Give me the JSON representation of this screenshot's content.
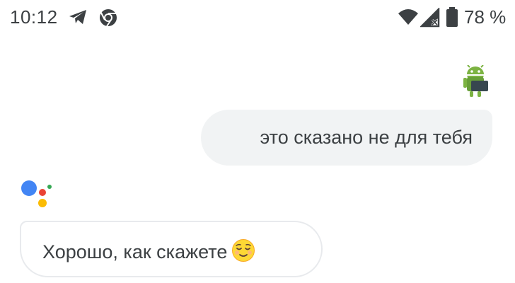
{
  "status_bar": {
    "time": "10:12",
    "left_icons": [
      "telegram-icon",
      "chrome-icon"
    ],
    "right_icons": [
      "wifi-icon",
      "signal-no-service-icon",
      "battery-icon"
    ],
    "battery_percent": "78 %"
  },
  "conversation": {
    "user_message": {
      "avatar": "android-robot-avatar",
      "text": "это сказано не для тебя"
    },
    "assistant_message": {
      "logo": "google-assistant-logo",
      "text": "Хорошо, как скажете",
      "emoji": "relieved-face-emoji"
    }
  },
  "colors": {
    "user_bubble_bg": "#f1f3f4",
    "assistant_bubble_border": "#e8eaed",
    "text": "#3c4043",
    "assistant_blue": "#4285f4",
    "assistant_red": "#ea4335",
    "assistant_yellow": "#fbbc04",
    "assistant_green": "#34a853"
  }
}
